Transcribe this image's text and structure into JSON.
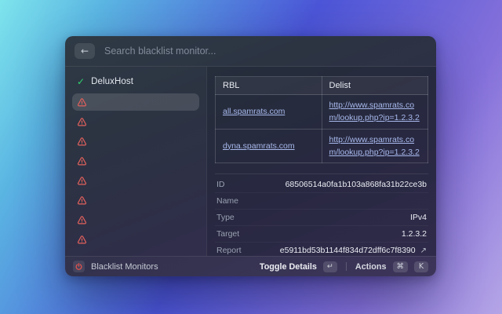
{
  "window": {
    "search_placeholder": "Search blacklist monitor..."
  },
  "sidebar": {
    "host_label": "DeluxHost",
    "alert_count": 8,
    "selected_index": 0
  },
  "table": {
    "headers": [
      "RBL",
      "Delist"
    ],
    "rows": [
      {
        "rbl": "all.spamrats.com",
        "delist": "http://www.spamrats.com/lookup.php?ip=1.2.3.2"
      },
      {
        "rbl": "dyna.spamrats.com",
        "delist": "http://www.spamrats.com/lookup.php?ip=1.2.3.2"
      }
    ]
  },
  "details": {
    "rows": [
      {
        "label": "ID",
        "value": "68506514a0fa1b103a868fa31b22ce3b"
      },
      {
        "label": "Name",
        "value": ""
      },
      {
        "label": "Type",
        "value": "IPv4"
      },
      {
        "label": "Target",
        "value": "1.2.3.2"
      },
      {
        "label": "Report",
        "value": "e5911bd53b1144f834d72dff6c7f8390"
      }
    ]
  },
  "footer": {
    "app_label": "Blacklist Monitors",
    "toggle_details_label": "Toggle Details",
    "actions_label": "Actions",
    "keys": {
      "enter": "↵",
      "cmd": "⌘",
      "k": "K"
    }
  },
  "glyphs": {
    "back": "←",
    "check": "✓",
    "external": "↗"
  },
  "colors": {
    "warning_red": "#e2615c",
    "success_green": "#2fd26d",
    "link": "#a8b9ec"
  }
}
